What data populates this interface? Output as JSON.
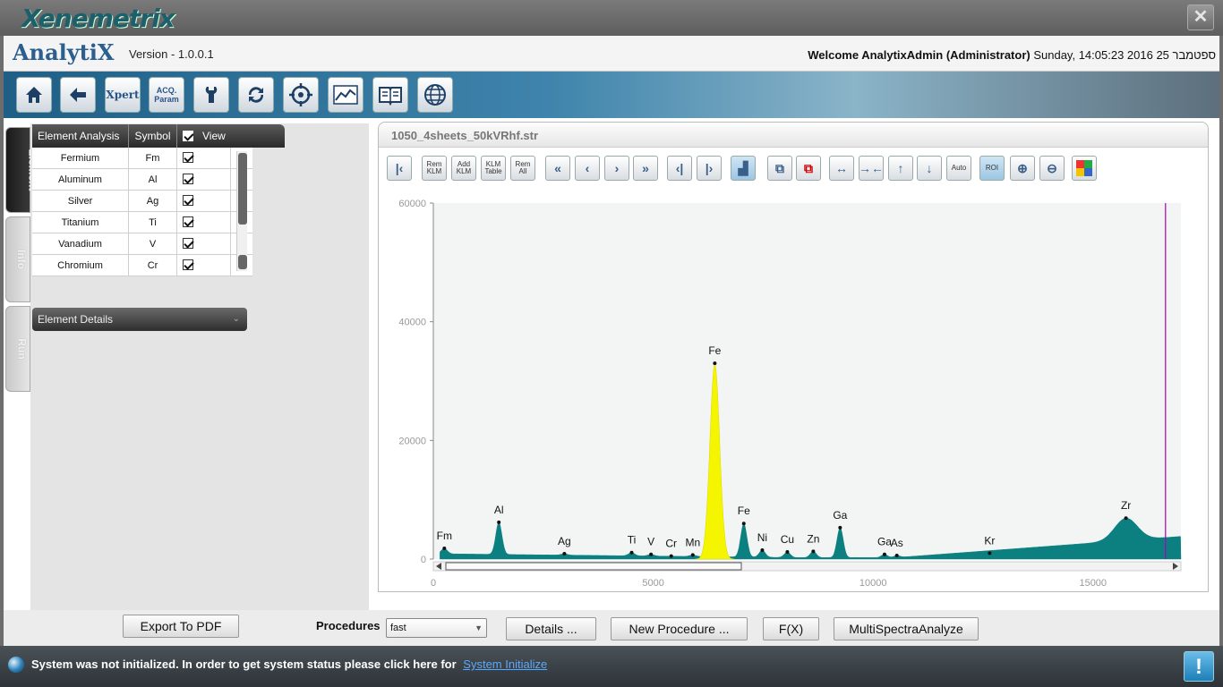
{
  "window": {
    "brand": "Xenemetrix",
    "close_label": "✕"
  },
  "header": {
    "app_name": "AnalytiX",
    "version": "Version - 1.0.0.1",
    "welcome": "Welcome AnalytixAdmin (Administrator)",
    "datetime": "Sunday, 14:05:23 2016 ספטמבר 25"
  },
  "toolbar": {
    "buttons": [
      "home",
      "back",
      "Xpert",
      "ACQ. Param",
      "tools",
      "refresh",
      "target",
      "chart",
      "manual",
      "web"
    ],
    "xpert_label": "Xpert",
    "acq_label_1": "ACQ.",
    "acq_label_2": "Param"
  },
  "side_tabs": {
    "element": "Element",
    "info": "Info",
    "run": "Run"
  },
  "element_grid": {
    "col_analysis": "Element Analysis",
    "col_symbol": "Symbol",
    "col_view": "View",
    "rows": [
      {
        "name": "Fermium",
        "symbol": "Fm"
      },
      {
        "name": "Aluminum",
        "symbol": "Al"
      },
      {
        "name": "Silver",
        "symbol": "Ag"
      },
      {
        "name": "Titanium",
        "symbol": "Ti"
      },
      {
        "name": "Vanadium",
        "symbol": "V"
      },
      {
        "name": "Chromium",
        "symbol": "Cr"
      }
    ]
  },
  "element_details": "Element Details",
  "spectrum": {
    "file_name": "1050_4sheets_50kVRhf.str",
    "btn_rem_klm": "Rem KLM",
    "btn_add_klm": "Add KLM",
    "btn_klm_table": "KLM Table",
    "btn_rem_all": "Rem All",
    "btn_auto": "Auto",
    "btn_roi": "ROI"
  },
  "chart_data": {
    "type": "line",
    "xlim": [
      0,
      17000
    ],
    "ylim": [
      0,
      60000
    ],
    "x_ticks": [
      "0",
      "5000",
      "10000",
      "15000"
    ],
    "y_ticks": [
      "0",
      "20000",
      "40000",
      "60000"
    ],
    "grid": false,
    "peaks": [
      {
        "label": "Fm",
        "x": 250,
        "y": 1800
      },
      {
        "label": "Al",
        "x": 1490,
        "y": 6200
      },
      {
        "label": "Ag",
        "x": 2980,
        "y": 900
      },
      {
        "label": "Ti",
        "x": 4510,
        "y": 1100
      },
      {
        "label": "V",
        "x": 4950,
        "y": 800
      },
      {
        "label": "Cr",
        "x": 5410,
        "y": 500
      },
      {
        "label": "Mn",
        "x": 5900,
        "y": 700
      },
      {
        "label": "Fe",
        "x": 6400,
        "y": 33000
      },
      {
        "label": "Fe",
        "x": 7060,
        "y": 6000
      },
      {
        "label": "Ni",
        "x": 7480,
        "y": 1500
      },
      {
        "label": "Cu",
        "x": 8050,
        "y": 1200
      },
      {
        "label": "Zn",
        "x": 8640,
        "y": 1300
      },
      {
        "label": "Ga",
        "x": 9250,
        "y": 5300
      },
      {
        "label": "Ga",
        "x": 10260,
        "y": 800
      },
      {
        "label": "As",
        "x": 10540,
        "y": 600
      },
      {
        "label": "Kr",
        "x": 12650,
        "y": 1000
      },
      {
        "label": "Zr",
        "x": 15750,
        "y": 6900
      }
    ],
    "highlighted_peak": "Fe",
    "fill_color": "#0c8080",
    "highlight_color": "#f5f500",
    "marker_color": "#b000b0"
  },
  "bottom": {
    "export_pdf": "Export To PDF",
    "procedures_label": "Procedures",
    "procedure_value": "fast",
    "details": "Details ...",
    "new_procedure": "New Procedure ...",
    "fx": "F(X)",
    "multi": "MultiSpectraAnalyze"
  },
  "status": {
    "message": "System was not initialized. In order to get system status please click here for",
    "link": "System Initialize",
    "alert": "!"
  }
}
